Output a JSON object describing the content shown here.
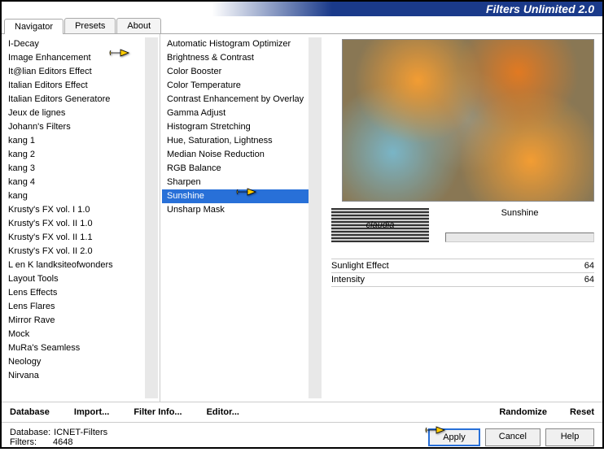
{
  "header": {
    "title": "Filters Unlimited 2.0"
  },
  "tabs": [
    {
      "label": "Navigator",
      "active": true
    },
    {
      "label": "Presets",
      "active": false
    },
    {
      "label": "About",
      "active": false
    }
  ],
  "categories": [
    "I-Decay",
    "Image Enhancement",
    "It@lian Editors Effect",
    "Italian Editors Effect",
    "Italian Editors Generatore",
    "Jeux de lignes",
    "Johann's Filters",
    "kang 1",
    "kang 2",
    "kang 3",
    "kang 4",
    "kang",
    "Krusty's FX vol. I 1.0",
    "Krusty's FX vol. II 1.0",
    "Krusty's FX vol. II 1.1",
    "Krusty's FX vol. II 2.0",
    "L en K landksiteofwonders",
    "Layout Tools",
    "Lens Effects",
    "Lens Flares",
    "Mirror Rave",
    "Mock",
    "MuRa's Seamless",
    "Neology",
    "Nirvana"
  ],
  "selectedCategoryIndex": 1,
  "filters": [
    "Automatic Histogram Optimizer",
    "Brightness & Contrast",
    "Color Booster",
    "Color Temperature",
    "Contrast Enhancement by Overlay",
    "Gamma Adjust",
    "Histogram Stretching",
    "Hue, Saturation, Lightness",
    "Median Noise Reduction",
    "RGB Balance",
    "Sharpen",
    "Sunshine",
    "Unsharp Mask"
  ],
  "selectedFilterIndex": 11,
  "logo": "claudia",
  "currentFilter": "Sunshine",
  "params": [
    {
      "name": "Sunlight Effect",
      "value": "64"
    },
    {
      "name": "Intensity",
      "value": "64"
    }
  ],
  "bottomBar": {
    "database": "Database",
    "import": "Import...",
    "filterInfo": "Filter Info...",
    "editor": "Editor...",
    "randomize": "Randomize",
    "reset": "Reset"
  },
  "status": {
    "dbLabel": "Database:",
    "dbValue": "ICNET-Filters",
    "filtersLabel": "Filters:",
    "filtersValue": "4648"
  },
  "buttons": {
    "apply": "Apply",
    "cancel": "Cancel",
    "help": "Help"
  }
}
